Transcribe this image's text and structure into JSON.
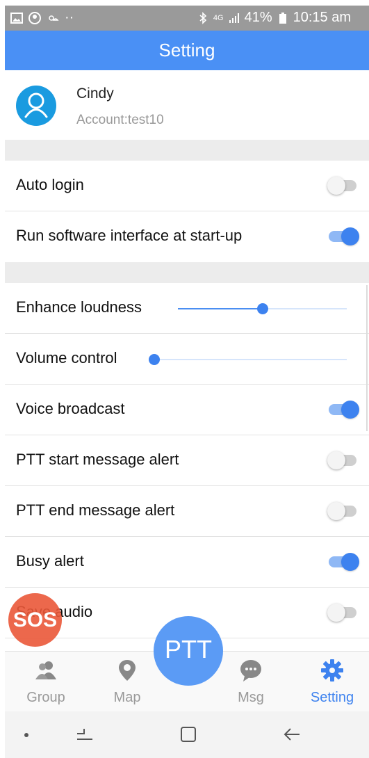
{
  "status_bar": {
    "battery": "41%",
    "time": "10:15 am",
    "network": "4G",
    "dots": "··"
  },
  "header": {
    "title": "Setting"
  },
  "profile": {
    "name": "Cindy",
    "account": "Account:test10"
  },
  "settings": {
    "auto_login": {
      "label": "Auto login",
      "on": false
    },
    "run_at_startup": {
      "label": "Run software interface at start-up",
      "on": true
    },
    "enhance_loudness": {
      "label": "Enhance loudness",
      "level": 0.5
    },
    "volume_control": {
      "label": "Volume control",
      "level": 0.0
    },
    "voice_broadcast": {
      "label": "Voice broadcast",
      "on": true
    },
    "ptt_start_alert": {
      "label": "PTT start message alert",
      "on": false
    },
    "ptt_end_alert": {
      "label": "PTT end message alert",
      "on": false
    },
    "busy_alert": {
      "label": "Busy alert",
      "on": true
    },
    "save_audio": {
      "label": "Save audio",
      "on": false
    }
  },
  "sos": {
    "label": "SOS"
  },
  "ptt": {
    "label": "PTT"
  },
  "nav": {
    "group": {
      "label": "Group",
      "icon": "group-icon"
    },
    "map": {
      "label": "Map",
      "icon": "map-pin-icon"
    },
    "msg": {
      "label": "Msg",
      "icon": "chat-icon"
    },
    "setting": {
      "label": "Setting",
      "icon": "gear-icon",
      "active": true
    }
  },
  "colors": {
    "accent": "#4a90f5",
    "toggle_on": "#3d82ef",
    "sos": "#ea5838",
    "avatar": "#1a9be0"
  }
}
